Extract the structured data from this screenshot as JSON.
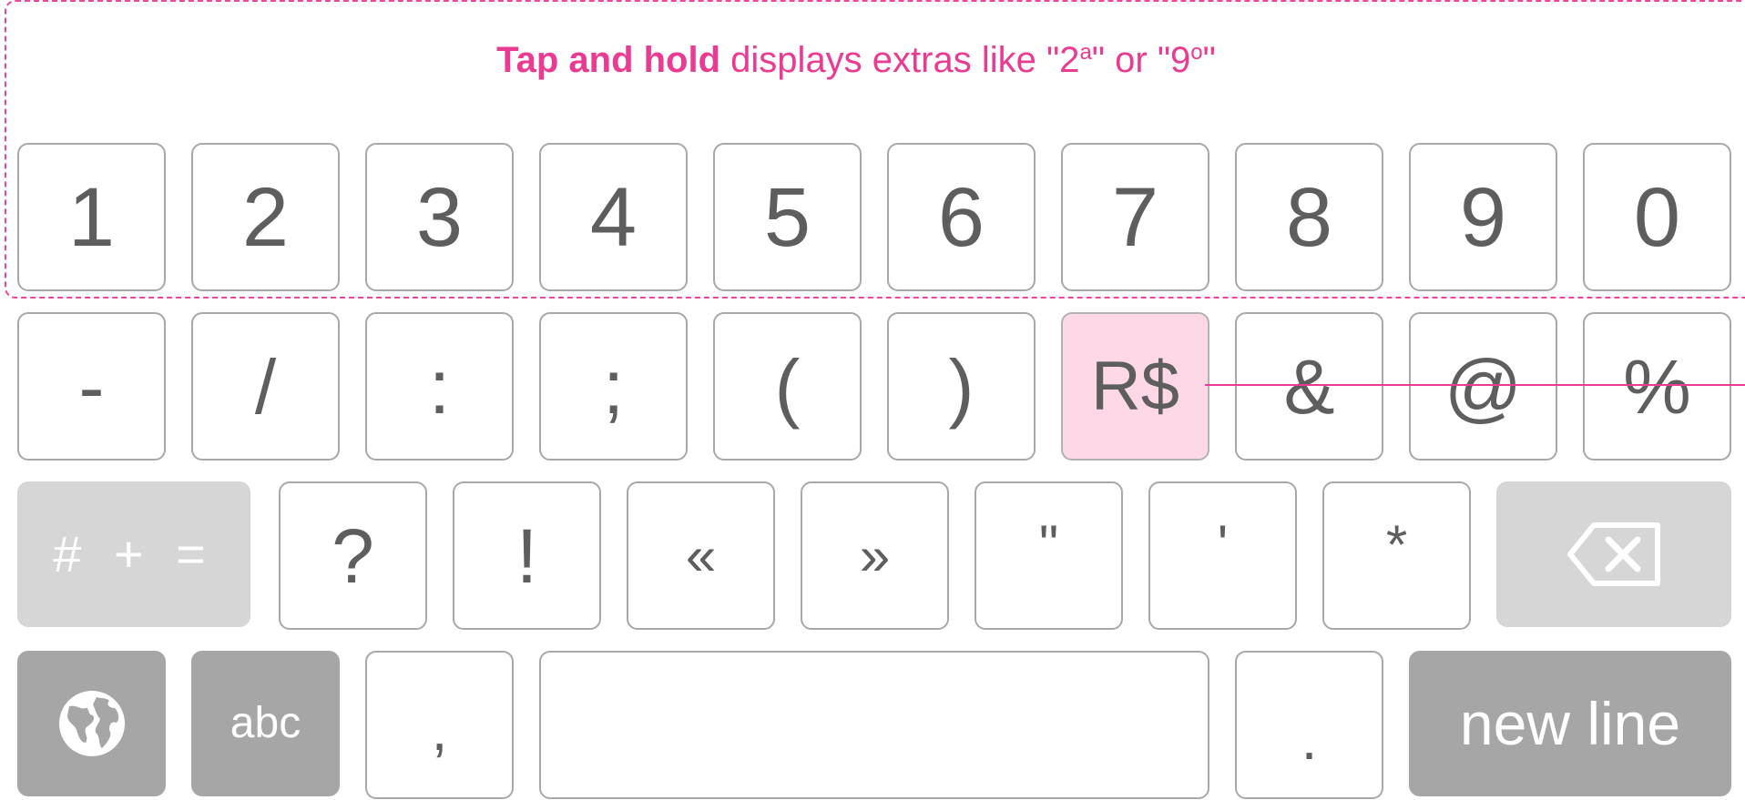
{
  "annotation": {
    "bold": "Tap and hold",
    "text": "displays extras like",
    "example1_base": "\"2",
    "example1_sup": "a",
    "example1_end": "\"",
    "connector": "or",
    "example2_base": "\"9",
    "example2_sup": "o",
    "example2_end": "\""
  },
  "rows": {
    "digits": [
      "1",
      "2",
      "3",
      "4",
      "5",
      "6",
      "7",
      "8",
      "9",
      "0"
    ],
    "symbols": [
      "-",
      "/",
      ":",
      ";",
      "(",
      ")",
      "R$",
      "&",
      "@",
      "%"
    ],
    "punct": [
      "?",
      "!",
      "«",
      "»",
      "\"",
      "'",
      "*"
    ]
  },
  "keys": {
    "more_symbols": "# + =",
    "abc": "abc",
    "comma": ",",
    "period": ".",
    "new_line": "new line",
    "globe_icon": "globe-icon",
    "backspace_icon": "backspace-icon"
  },
  "colors": {
    "accent": "#ea3a92",
    "highlight_key": "#ffd8e8",
    "key_text": "#5e5e5e",
    "function_key_light": "#d6d6d6",
    "function_key_dark": "#a6a6a6"
  }
}
